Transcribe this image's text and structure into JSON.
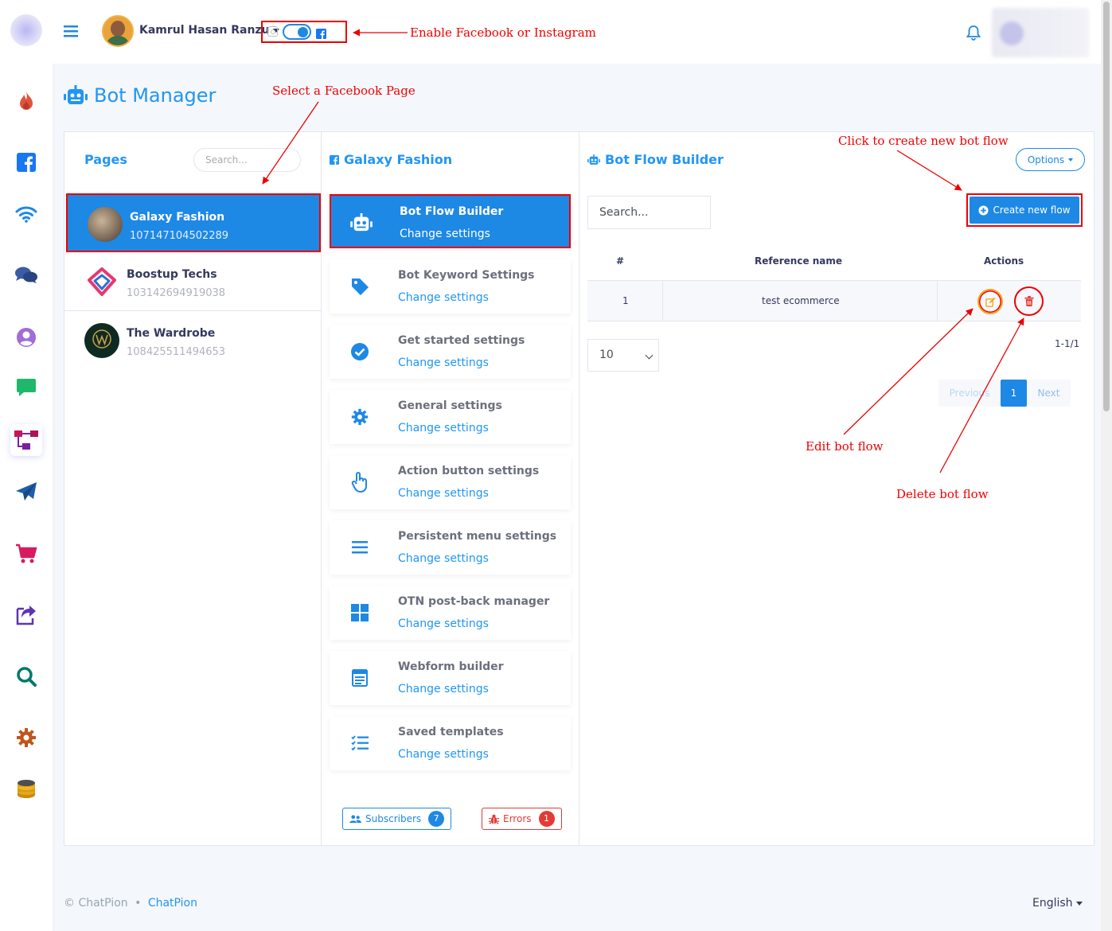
{
  "user": {
    "name": "Kamrul Hasan Ranzu"
  },
  "page": {
    "title": "Bot Manager"
  },
  "pages_panel": {
    "heading": "Pages",
    "search_placeholder": "Search...",
    "items": [
      {
        "name": "Galaxy Fashion",
        "id": "107147104502289"
      },
      {
        "name": "Boostup Techs",
        "id": "103142694919038"
      },
      {
        "name": "The Wardrobe",
        "id": "108425511494653"
      }
    ]
  },
  "settings_panel": {
    "heading": "Galaxy Fashion",
    "items": [
      {
        "title": "Bot Flow Builder",
        "link": "Change settings",
        "icon": "robot-icon"
      },
      {
        "title": "Bot Keyword Settings",
        "link": "Change settings",
        "icon": "tag-icon"
      },
      {
        "title": "Get started settings",
        "link": "Change settings",
        "icon": "check-circle-icon"
      },
      {
        "title": "General settings",
        "link": "Change settings",
        "icon": "gear-icon"
      },
      {
        "title": "Action button settings",
        "link": "Change settings",
        "icon": "hand-pointer-icon"
      },
      {
        "title": "Persistent menu settings",
        "link": "Change settings",
        "icon": "bars-icon"
      },
      {
        "title": "OTN post-back manager",
        "link": "Change settings",
        "icon": "grid-icon"
      },
      {
        "title": "Webform builder",
        "link": "Change settings",
        "icon": "form-icon"
      },
      {
        "title": "Saved templates",
        "link": "Change settings",
        "icon": "list-check-icon"
      }
    ],
    "subscribers_label": "Subscribers",
    "subscribers_count": "7",
    "errors_label": "Errors",
    "errors_count": "1"
  },
  "flow_panel": {
    "heading": "Bot Flow Builder",
    "options_label": "Options",
    "search_placeholder": "Search...",
    "create_label": "Create new flow",
    "columns": [
      "#",
      "Reference name",
      "Actions"
    ],
    "rows": [
      {
        "num": "1",
        "name": "test ecommerce"
      }
    ],
    "page_length": "10",
    "info": "1-1/1",
    "pager": {
      "prev": "Previous",
      "current": "1",
      "next": "Next"
    }
  },
  "annotations": {
    "toggle": "Enable Facebook or Instagram",
    "select_page": "Select a Facebook Page",
    "create_flow": "Click to create new bot flow",
    "edit_flow": "Edit bot flow",
    "delete_flow": "Delete bot flow"
  },
  "footer": {
    "copyright": "© ChatPion",
    "separator": "•",
    "link": "ChatPion",
    "language": "English"
  },
  "colors": {
    "primary": "#1e88e5",
    "annotation": "#e00000",
    "danger": "#e53935",
    "warning": "#f5a623"
  }
}
